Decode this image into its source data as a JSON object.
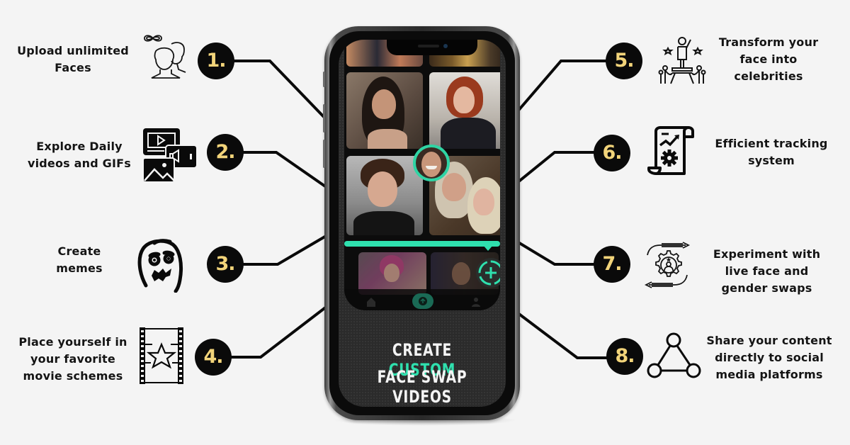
{
  "colors": {
    "background": "#f4f4f4",
    "badge_bg": "#0a0a0a",
    "badge_text": "#f2d47a",
    "accent": "#2fe0ae",
    "text": "#141414"
  },
  "features": [
    {
      "number": "1.",
      "lines": [
        "Upload unlimited",
        "Faces"
      ],
      "icon": "infinity-faces-icon"
    },
    {
      "number": "2.",
      "lines": [
        "Explore Daily",
        "videos and GIFs"
      ],
      "icon": "media-video-gif-icon"
    },
    {
      "number": "3.",
      "lines": [
        "Create",
        "memes"
      ],
      "icon": "meme-face-icon"
    },
    {
      "number": "4.",
      "lines": [
        "Place yourself in",
        "your favorite",
        "movie schemes"
      ],
      "icon": "film-strip-star-icon"
    },
    {
      "number": "5.",
      "lines": [
        "Transform your",
        "face into",
        "celebrities"
      ],
      "icon": "celebrity-stage-icon"
    },
    {
      "number": "6.",
      "lines": [
        "Efficient tracking",
        "system"
      ],
      "icon": "tracking-report-icon"
    },
    {
      "number": "7.",
      "lines": [
        "Experiment with",
        "live face and",
        "gender swaps"
      ],
      "icon": "swap-gear-user-icon"
    },
    {
      "number": "8.",
      "lines": [
        "Share your content",
        "directly to social",
        "media platforms"
      ],
      "icon": "share-network-icon"
    }
  ],
  "phone": {
    "headline_line1_prefix": "CREATE ",
    "headline_line1_accent": "CUSTOM",
    "headline_line2": "FACE SWAP VIDEOS",
    "nav_items": [
      "home-icon",
      "upload-icon",
      "profile-icon"
    ]
  }
}
